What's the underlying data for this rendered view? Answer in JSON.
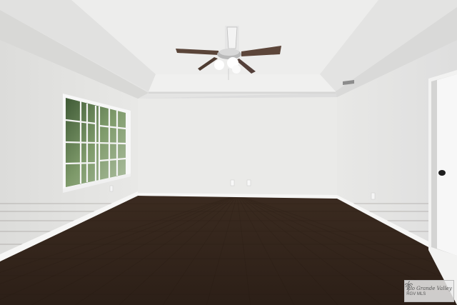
{
  "scene": {
    "title": "",
    "colors": {
      "wall_left": "#e6e6e4",
      "wall_back": "#eeeeed",
      "wall_right": "#e9e9e7",
      "ceiling": "#e9e9e8",
      "tray_ceiling": "#f2f2f2",
      "floor_dark": "#33251c",
      "floor_mid": "#4a3626",
      "baseboard": "#f4f4f4",
      "window_glass": "#5e7a52",
      "trim": "#f7f7f7"
    },
    "objects": [
      {
        "name": "ceiling-fan",
        "icon": "ceiling-fan-icon"
      },
      {
        "name": "window",
        "icon": "window-icon"
      },
      {
        "name": "door",
        "icon": "door-icon"
      },
      {
        "name": "hardwood-floor"
      },
      {
        "name": "tray-ceiling"
      }
    ]
  },
  "watermark": {
    "line1": "Rio Grande Valley",
    "line2": "RGV MLS",
    "icon": "palm-tree-icon"
  }
}
